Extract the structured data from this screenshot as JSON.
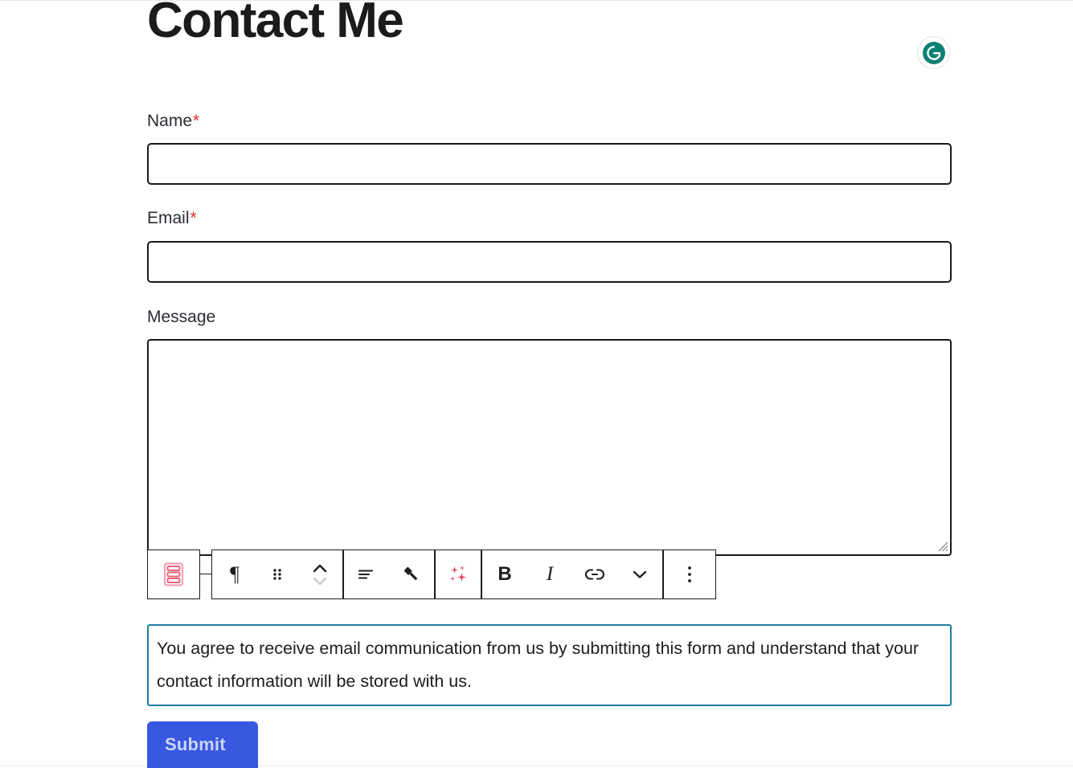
{
  "page": {
    "title": "Contact Me",
    "background_color": "#ffffff"
  },
  "grammarly": {
    "name": "grammarly-icon",
    "label": "G",
    "color": "#0d8073"
  },
  "form": {
    "fields": [
      {
        "label": "Name",
        "required": true,
        "required_marker": "*",
        "value": "",
        "placeholder": "",
        "type": "text"
      },
      {
        "label": "Email",
        "required": true,
        "required_marker": "*",
        "value": "",
        "placeholder": "",
        "type": "text"
      },
      {
        "label": "Message",
        "required": false,
        "required_marker": "",
        "value": "",
        "placeholder": "",
        "type": "textarea"
      }
    ]
  },
  "toolbar": {
    "block_type_icon": "form-block-icon",
    "block_type_color": "#e8647c",
    "items": [
      {
        "name": "paragraph-icon",
        "glyph": "¶",
        "label": "Paragraph"
      },
      {
        "name": "drag-handle-icon",
        "glyph": "",
        "label": "Drag"
      },
      {
        "name": "move-up-down-icon",
        "glyph": "",
        "label": "Move up or down"
      },
      {
        "name": "align-text-icon",
        "glyph": "",
        "label": "Align text"
      },
      {
        "name": "paint-brush-icon",
        "glyph": "",
        "label": "Styles"
      },
      {
        "name": "ai-sparkles-icon",
        "glyph": "",
        "label": "AI assist"
      },
      {
        "name": "bold-icon",
        "glyph": "B",
        "label": "Bold"
      },
      {
        "name": "italic-icon",
        "glyph": "I",
        "label": "Italic"
      },
      {
        "name": "link-icon",
        "glyph": "",
        "label": "Link"
      },
      {
        "name": "chevron-down-icon",
        "glyph": "",
        "label": "More formatting"
      },
      {
        "name": "kebab-menu-icon",
        "glyph": "",
        "label": "Options"
      }
    ],
    "ai_color": "#e0405a",
    "border_color": "#1e1e1e"
  },
  "consent": {
    "text": "You agree to receive email communication from us by submitting this form and understand that your contact information will be stored with us.",
    "border_color": "#1b7f9e"
  },
  "submit": {
    "label": "Submit",
    "background_color": "#3858e0",
    "text_color": "#ccd5f7"
  }
}
